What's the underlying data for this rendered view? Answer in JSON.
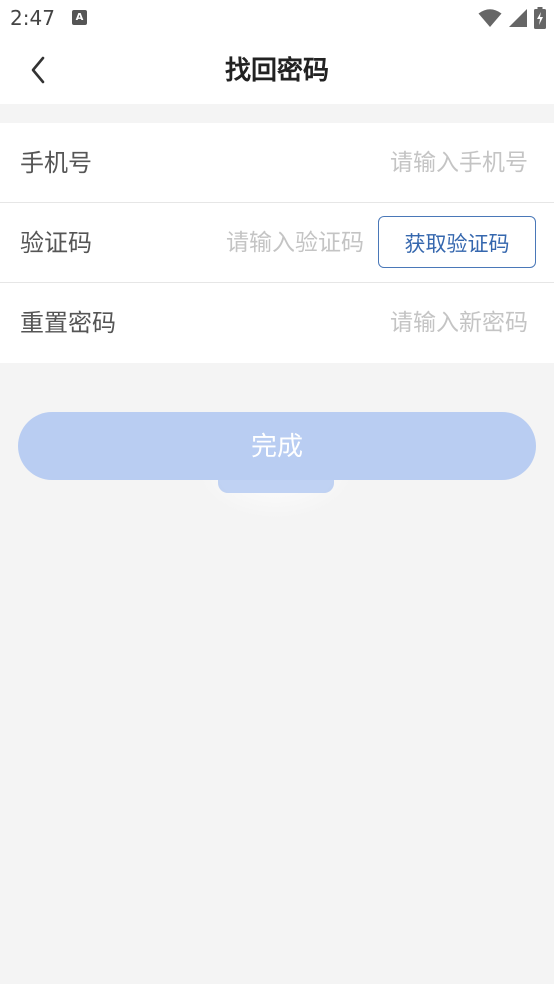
{
  "status_bar": {
    "time": "2:47",
    "app_icon_letter": "A",
    "icons": [
      "wifi-icon",
      "signal-icon",
      "battery-charging-icon"
    ]
  },
  "header": {
    "title": "找回密码",
    "back_icon": "chevron-left-icon"
  },
  "form": {
    "phone": {
      "label": "手机号",
      "value": "",
      "placeholder": "请输入手机号"
    },
    "code": {
      "label": "验证码",
      "value": "",
      "placeholder": "请输入验证码",
      "button_label": "获取验证码"
    },
    "password": {
      "label": "重置密码",
      "value": "",
      "placeholder": "请输入新密码"
    }
  },
  "submit": {
    "label": "完成"
  },
  "colors": {
    "background": "#f4f4f4",
    "accent": "#3567ae",
    "submit_disabled": "#b9cdf2"
  }
}
